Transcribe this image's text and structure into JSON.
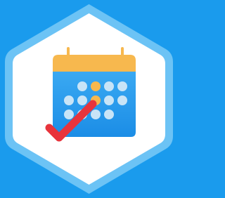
{
  "icon": {
    "name": "calendar-check-icon",
    "badge_shape": "hexagon"
  },
  "colors": {
    "background": "#1a9bed",
    "hexagon_border": "#6cc3f5",
    "hexagon_fill": "#ffffff",
    "calendar_header": "#f7b84e",
    "calendar_body_top": "#3aa9f2",
    "calendar_body_bottom": "#1b8de6",
    "dot_default": "#c8e4f7",
    "dot_highlight": "#f7b84e",
    "checkmark": "#e8343c"
  },
  "calendar": {
    "rows": 3,
    "highlighted_dots": [
      [
        0,
        1
      ],
      [
        1,
        2
      ]
    ]
  }
}
